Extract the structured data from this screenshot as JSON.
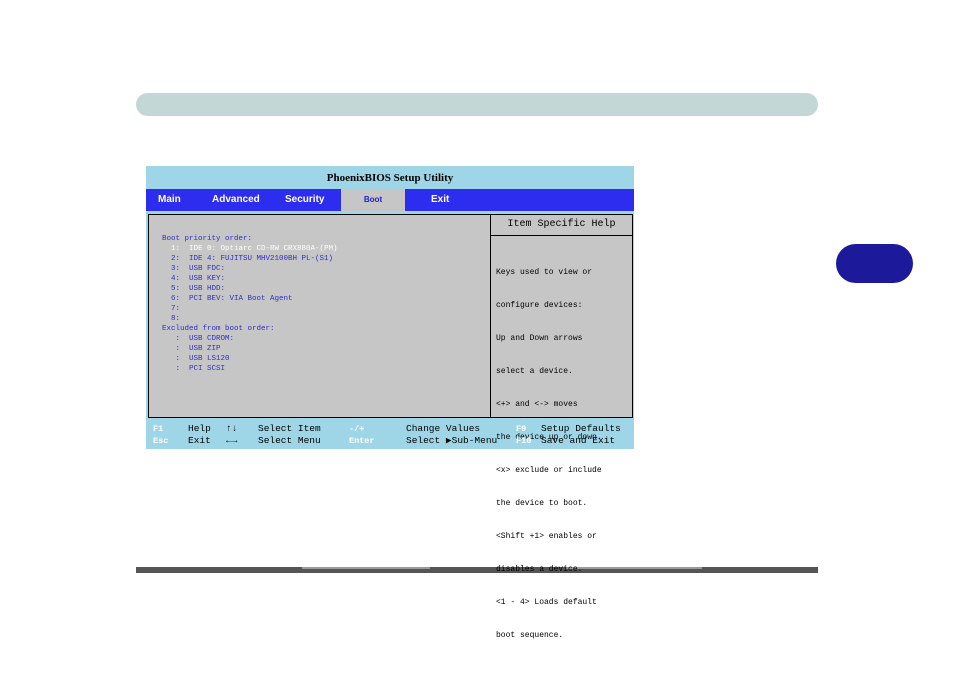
{
  "bios": {
    "title": "PhoenixBIOS Setup Utility",
    "menu": [
      "Main",
      "Advanced",
      "Security",
      "Boot",
      "Exit"
    ],
    "active_menu": "Boot",
    "boot_lines": [
      "Boot priority order:",
      "  1:  IDE 0: Optiarc CD-RW CRX880A-(PM)",
      "  2:  IDE 4: FUJITSU MHV2100BH PL-(S1)",
      "  3:  USB FDC:",
      "  4:  USB KEY:",
      "  5:  USB HDD:",
      "  6:  PCI BEV: VIA Boot Agent",
      "  7:",
      "  8:",
      "Excluded from boot order:",
      "   :  USB CDROM:",
      "   :  USB ZIP",
      "   :  USB LS120",
      "   :  PCI SCSI"
    ],
    "help_title": "Item Specific Help",
    "help_lines": [
      "Keys used to view or",
      "configure devices:",
      "Up and Down arrows",
      "select a device.",
      "<+> and <-> moves",
      "the device up or down.",
      "<x> exclude or include",
      "the device to boot.",
      "<Shift +1> enables or",
      "disables a device.",
      "<1 - 4> Loads default",
      "boot sequence."
    ],
    "legend": {
      "row1": {
        "k1": "F1",
        "t1": "Help",
        "k2": "↑↓",
        "t2": "Select Item",
        "k3": "-/+",
        "t3": "Change Values",
        "k4": "F9",
        "t4": "Setup Defaults"
      },
      "row2": {
        "k1": "Esc",
        "t1": "Exit",
        "k2": "←→",
        "t2": "Select Menu",
        "k3": "Enter",
        "t3": "Select ▶Sub-Menu",
        "k4": "F10",
        "t4": "Save and Exit"
      }
    }
  },
  "colors": {
    "bios_bg": "#9ed6e8",
    "menubar": "#2d2df0",
    "panel": "#c6c6c6",
    "boot_text": "#2e2ec8",
    "side_tab": "#1c1a9a"
  }
}
